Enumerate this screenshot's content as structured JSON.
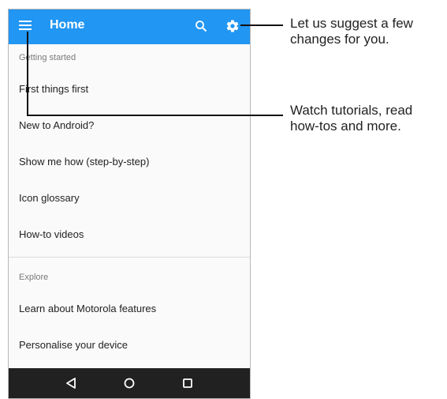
{
  "app_bar": {
    "title": "Home",
    "icons": [
      "menu-icon",
      "search-icon",
      "gear-icon"
    ],
    "color": "#2196f3"
  },
  "sections": [
    {
      "header": "Getting started",
      "items": [
        "First things first",
        "New to Android?",
        "Show me how (step-by-step)",
        "Icon glossary",
        "How-to videos"
      ]
    },
    {
      "header": "Explore",
      "items": [
        "Learn about Motorola features",
        "Personalise your device"
      ]
    }
  ],
  "nav_bar": {
    "icons": [
      "back-icon",
      "home-icon",
      "recents-icon"
    ],
    "color": "#212121"
  },
  "callouts": {
    "settings": [
      "Let us suggest a few",
      "changes for you."
    ],
    "menu": [
      "Watch tutorials, read",
      "how-tos and more."
    ]
  }
}
